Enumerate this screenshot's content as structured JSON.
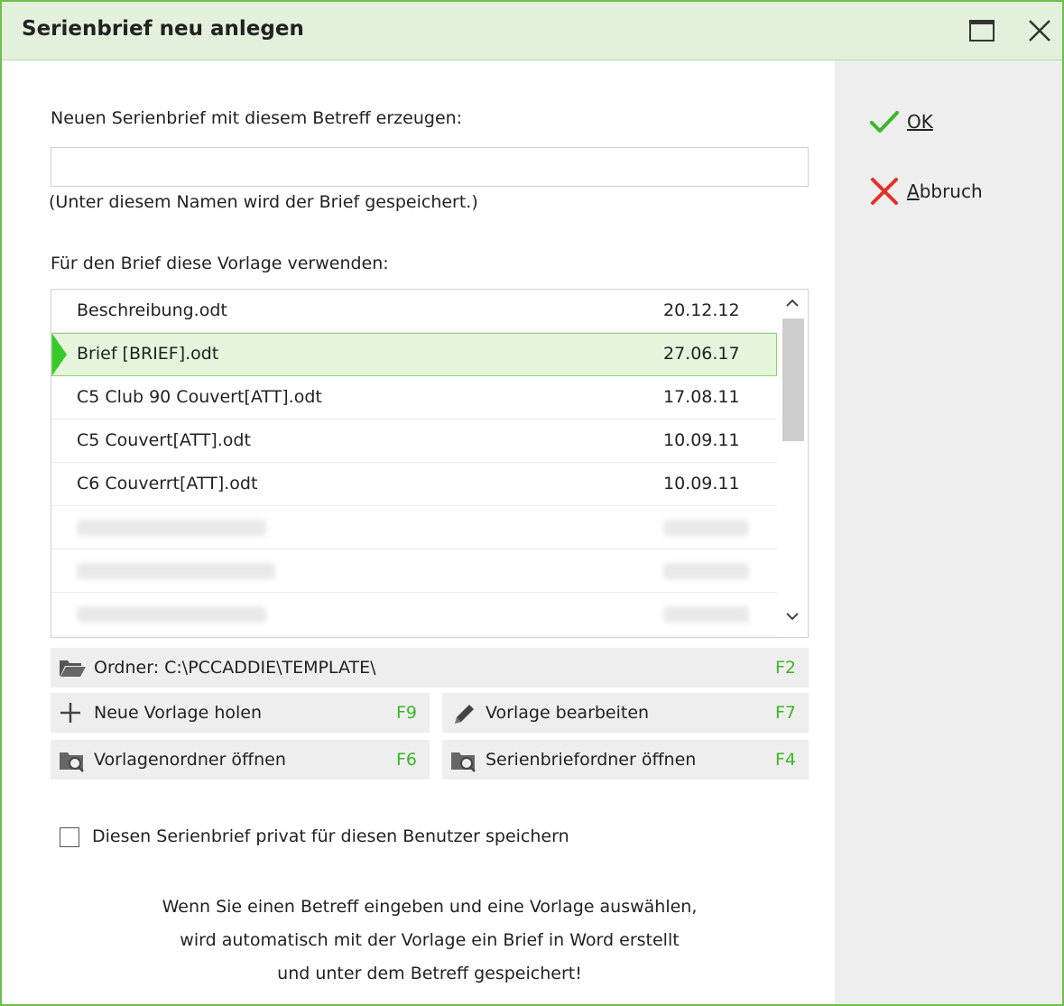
{
  "window": {
    "title": "Serienbrief neu anlegen"
  },
  "side": {
    "ok_label": "OK",
    "cancel_label": "Abbruch"
  },
  "form": {
    "subject_label": "Neuen Serienbrief mit diesem Betreff erzeugen:",
    "subject_value": "",
    "subject_hint": "(Unter diesem Namen wird der Brief gespeichert.)",
    "template_label": "Für den Brief diese Vorlage verwenden:"
  },
  "templates": [
    {
      "name": "Beschreibung.odt",
      "date": "20.12.12"
    },
    {
      "name": "Brief [BRIEF].odt",
      "date": "27.06.17",
      "selected": true
    },
    {
      "name": "C5 Club 90 Couvert[ATT].odt",
      "date": "17.08.11"
    },
    {
      "name": "C5 Couvert[ATT].odt",
      "date": "10.09.11"
    },
    {
      "name": "C6 Couverrt[ATT].odt",
      "date": "10.09.11"
    }
  ],
  "actions": {
    "folder_label": "Ordner: C:\\PCCADDIE\\TEMPLATE\\",
    "folder_key": "F2",
    "new_template_label": "Neue Vorlage holen",
    "new_template_key": "F9",
    "edit_template_label": "Vorlage bearbeiten",
    "edit_template_key": "F7",
    "open_template_folder_label": "Vorlagenordner öffnen",
    "open_template_folder_key": "F6",
    "open_letter_folder_label": "Serienbriefordner öffnen",
    "open_letter_folder_key": "F4"
  },
  "private_checkbox": {
    "label": "Diesen Serienbrief privat für diesen Benutzer speichern",
    "checked": false
  },
  "info": {
    "line1": "Wenn Sie einen Betreff eingeben und eine Vorlage auswählen,",
    "line2": "wird automatisch mit der Vorlage ein Brief in Word erstellt",
    "line3": "und unter dem Betreff gespeichert!"
  },
  "colors": {
    "accent": "#6cbf4b",
    "titlebar": "#e3f1dc",
    "selection": "#e4f5db",
    "hotkey": "#3cb62a",
    "cancel_icon": "#e0322a"
  }
}
